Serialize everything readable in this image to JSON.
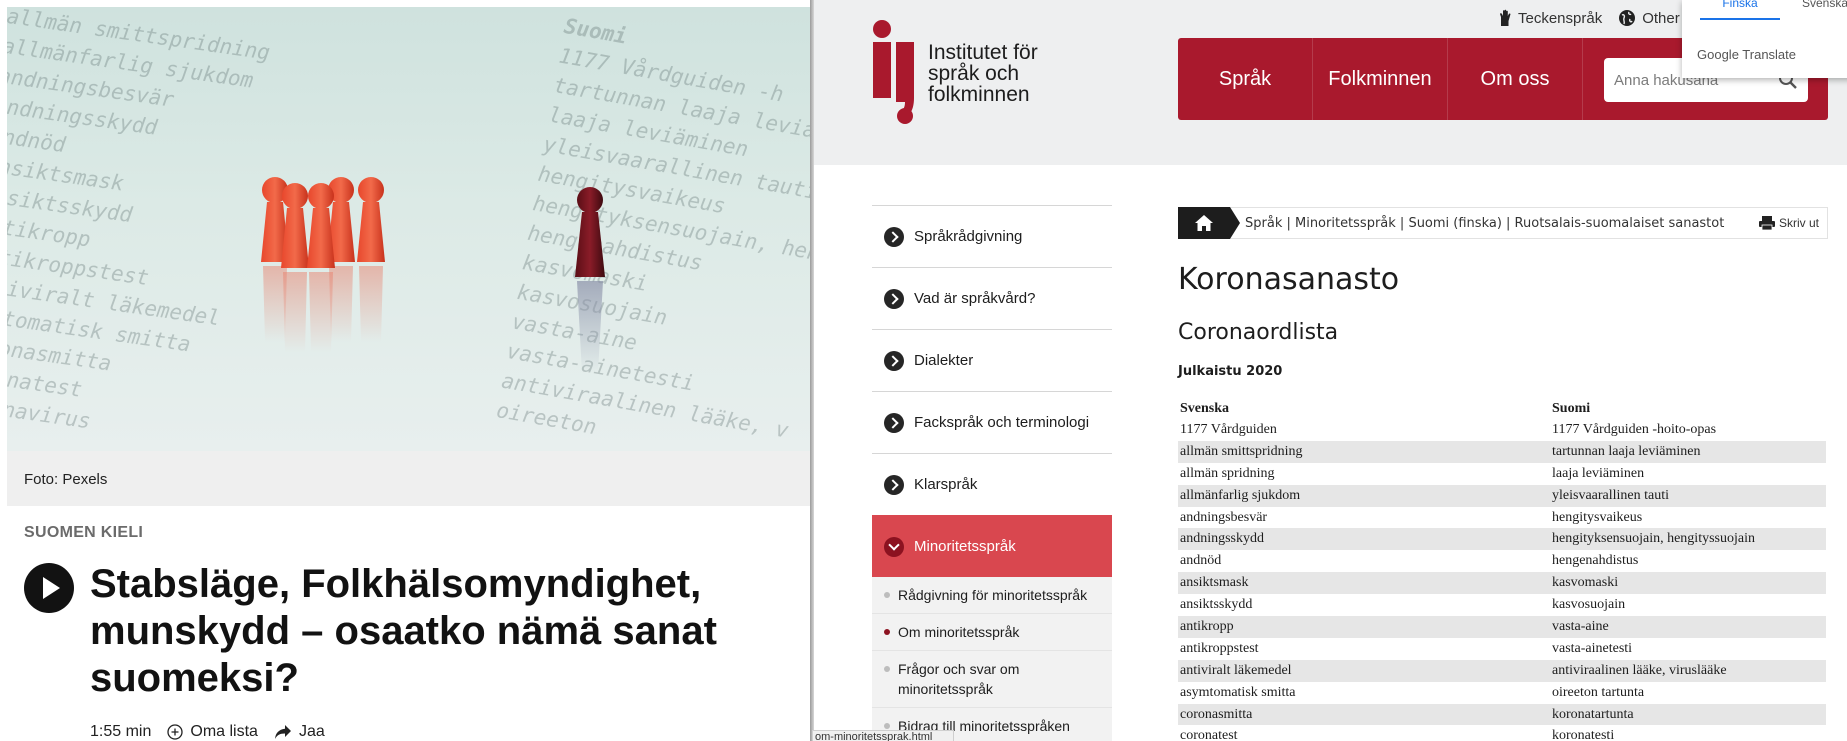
{
  "article": {
    "photo_words_left": [
      "allmän smittspridning",
      "allmänfarlig sjukdom",
      "andningsbesvär",
      "andningsskydd",
      "andnöd",
      "ansiktsmask",
      "ansiktsskydd",
      "antikropp",
      "antikroppstest",
      "antiviralt läkemedel",
      "symtomatisk smitta",
      "coronasmitta",
      "coronatest",
      "coronavirus"
    ],
    "photo_words_right": [
      "Suomi",
      "1177 Vårdguiden -h",
      "tartunnan laaja levia",
      "laaja leviäminen",
      "yleisvaarallinen tauti",
      "hengitysvaikeus",
      "hengityksensuojain, hen",
      "hengenahdistus",
      "kasvomaski",
      "kasvosuojain",
      "vasta-aine",
      "vasta-ainetesti",
      "antiviraalinen lääke, v",
      "oireeton"
    ],
    "caption": "Foto: Pexels",
    "category": "SUOMEN KIELI",
    "headline": "Stabsläge, Folkhälsomyndighet, munskydd – osaatko nämä sanat suomeksi?",
    "duration": "1:55 min",
    "add_list_label": "Oma lista",
    "share_label": "Jaa"
  },
  "site": {
    "logo_lines": [
      "Institutet för",
      "språk och",
      "folkminnen"
    ],
    "top_links": {
      "sign_language": "Teckenspråk",
      "other_languages": "Other l"
    },
    "nav": [
      "Språk",
      "Folkminnen",
      "Om oss"
    ],
    "search_placeholder": "Anna hakusana",
    "google_translate": {
      "tab1": "Finska",
      "tab2": "Svenska",
      "brand": "Google Translate"
    },
    "sidebar": {
      "items": [
        "Språkrådgivning",
        "Vad är språkvård?",
        "Dialekter",
        "Fackspråk och terminologi",
        "Klarspråk"
      ],
      "active_item": "Minoritetsspråk",
      "sub_items": [
        "Rådgivning för minoritetsspråk",
        "Om minoritetsspråk",
        "Frågor och svar om minoritetsspråk",
        "Bidrag till minoritetsspråken"
      ]
    },
    "breadcrumb": "Språk | Minoritetsspråk | Suomi (finska) | Ruotsalais-suomalaiset sanastot",
    "print_label": "Skriv ut",
    "page_title": "Koronasanasto",
    "page_subtitle": "Coronaordlista",
    "published": "Julkaistu 2020",
    "table": {
      "headers": [
        "Svenska",
        "Suomi"
      ],
      "rows": [
        [
          "1177 Vårdguiden",
          "1177 Vårdguiden -hoito-opas"
        ],
        [
          "allmän smittspridning",
          "tartunnan laaja leviäminen"
        ],
        [
          "allmän spridning",
          "laaja leviäminen"
        ],
        [
          "allmänfarlig sjukdom",
          "yleisvaarallinen tauti"
        ],
        [
          "andningsbesvär",
          "hengitysvaikeus"
        ],
        [
          "andningsskydd",
          "hengityksensuojain, hengityssuojain"
        ],
        [
          "andnöd",
          "hengenahdistus"
        ],
        [
          "ansiktsmask",
          "kasvomaski"
        ],
        [
          "ansiktsskydd",
          "kasvosuojain"
        ],
        [
          "antikropp",
          "vasta-aine"
        ],
        [
          "antikroppstest",
          "vasta-ainetesti"
        ],
        [
          "antiviralt läkemedel",
          "antiviraalinen lääke, viruslääke"
        ],
        [
          "asymtomatisk smitta",
          "oireeton tartunta"
        ],
        [
          "coronasmitta",
          "koronatartunta"
        ],
        [
          "coronatest",
          "koronatesti"
        ]
      ]
    },
    "status_url": "om-minoritetssprak.html"
  },
  "colors": {
    "brand_red": "#a9192d",
    "active_red": "#d9474f",
    "dark": "#1d1d1d"
  }
}
